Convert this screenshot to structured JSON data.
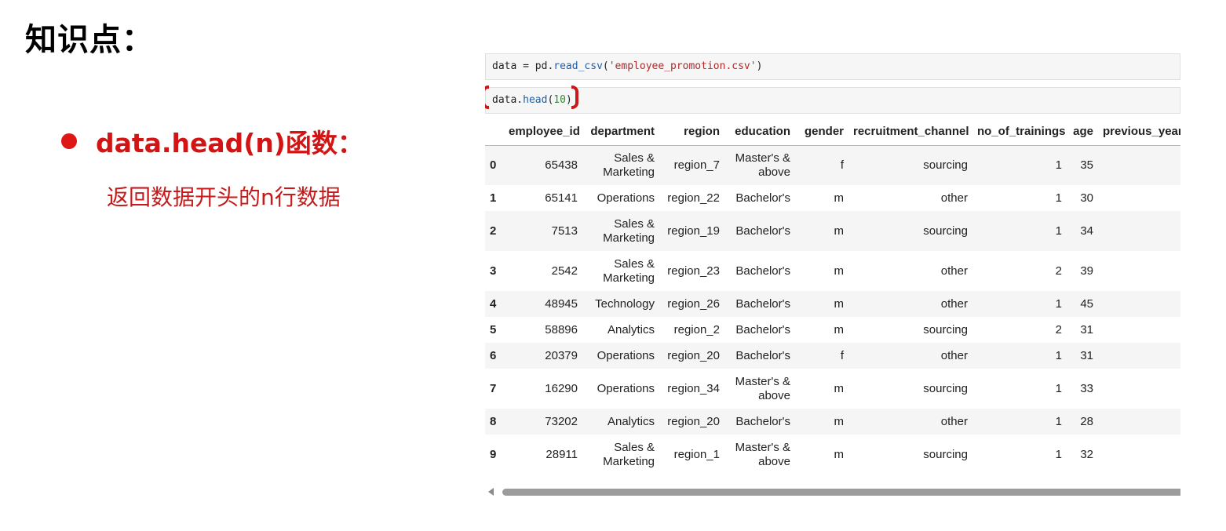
{
  "slide": {
    "title": "知识点：",
    "bullet": "data.head(n)函数：",
    "description": "返回数据开头的n行数据"
  },
  "notebook": {
    "cell1": {
      "var": "data",
      "op": " = pd.",
      "fn": "read_csv",
      "open": "(",
      "arg": "'employee_promotion.csv'",
      "close": ")"
    },
    "cell2": {
      "var": "data.",
      "fn": "head",
      "open": "(",
      "arg": "10",
      "close": ")"
    }
  },
  "table": {
    "columns": [
      "",
      "employee_id",
      "department",
      "region",
      "education",
      "gender",
      "recruitment_channel",
      "no_of_trainings",
      "age",
      "previous_year_ra"
    ],
    "rows": [
      [
        "0",
        "65438",
        "Sales & Marketing",
        "region_7",
        "Master's & above",
        "f",
        "sourcing",
        "1",
        "35",
        ""
      ],
      [
        "1",
        "65141",
        "Operations",
        "region_22",
        "Bachelor's",
        "m",
        "other",
        "1",
        "30",
        ""
      ],
      [
        "2",
        "7513",
        "Sales & Marketing",
        "region_19",
        "Bachelor's",
        "m",
        "sourcing",
        "1",
        "34",
        ""
      ],
      [
        "3",
        "2542",
        "Sales & Marketing",
        "region_23",
        "Bachelor's",
        "m",
        "other",
        "2",
        "39",
        ""
      ],
      [
        "4",
        "48945",
        "Technology",
        "region_26",
        "Bachelor's",
        "m",
        "other",
        "1",
        "45",
        ""
      ],
      [
        "5",
        "58896",
        "Analytics",
        "region_2",
        "Bachelor's",
        "m",
        "sourcing",
        "2",
        "31",
        ""
      ],
      [
        "6",
        "20379",
        "Operations",
        "region_20",
        "Bachelor's",
        "f",
        "other",
        "1",
        "31",
        ""
      ],
      [
        "7",
        "16290",
        "Operations",
        "region_34",
        "Master's & above",
        "m",
        "sourcing",
        "1",
        "33",
        ""
      ],
      [
        "8",
        "73202",
        "Analytics",
        "region_20",
        "Bachelor's",
        "m",
        "other",
        "1",
        "28",
        ""
      ],
      [
        "9",
        "28911",
        "Sales & Marketing",
        "region_1",
        "Master's & above",
        "m",
        "sourcing",
        "1",
        "32",
        ""
      ]
    ]
  },
  "colors": {
    "accent": "#d31414",
    "bullet": "#e01616",
    "highlight": "#c81818"
  },
  "icons": {
    "scroll_left": "triangle-left-icon",
    "bullet": "circle-bullet-icon"
  }
}
